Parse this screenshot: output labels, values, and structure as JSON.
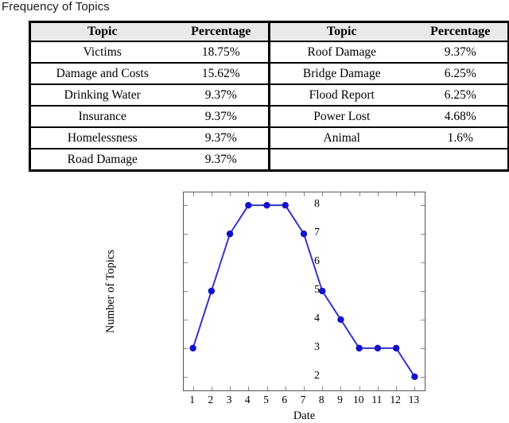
{
  "page": {
    "title": "Frequency of Topics"
  },
  "table": {
    "headers": [
      "Topic",
      "Percentage",
      "Topic",
      "Percentage"
    ],
    "rows": [
      [
        "Victims",
        "18.75%",
        "Roof Damage",
        "9.37%"
      ],
      [
        "Damage and Costs",
        "15.62%",
        "Bridge Damage",
        "6.25%"
      ],
      [
        "Drinking Water",
        "9.37%",
        "Flood Report",
        "6.25%"
      ],
      [
        "Insurance",
        "9.37%",
        "Power Lost",
        "4.68%"
      ],
      [
        "Homelessness",
        "9.37%",
        "Animal",
        "1.6%"
      ],
      [
        "Road Damage",
        "9.37%",
        "",
        ""
      ]
    ],
    "header_background": "#e9e9e9",
    "border_color": "#000000"
  },
  "chart_data": {
    "type": "line",
    "title": "",
    "xlabel": "Date",
    "ylabel": "Number of Topics",
    "x": [
      1,
      2,
      3,
      4,
      5,
      6,
      7,
      8,
      9,
      10,
      11,
      12,
      13
    ],
    "values": [
      3,
      5,
      7,
      8,
      8,
      8,
      7,
      5,
      4,
      3,
      3,
      3,
      2
    ],
    "xticks": [
      "1",
      "2",
      "3",
      "4",
      "5",
      "6",
      "7",
      "8",
      "9",
      "10",
      "11",
      "12",
      "13"
    ],
    "yticks": [
      "2",
      "3",
      "4",
      "5",
      "6",
      "7",
      "8"
    ],
    "xlim": [
      0.5,
      13.5
    ],
    "ylim": [
      1.55,
      8.45
    ],
    "grid": false,
    "legend": null,
    "line_color": "#3333cc",
    "marker_color": "#1111cc",
    "marker": "circle",
    "frame_color": "#555555"
  }
}
